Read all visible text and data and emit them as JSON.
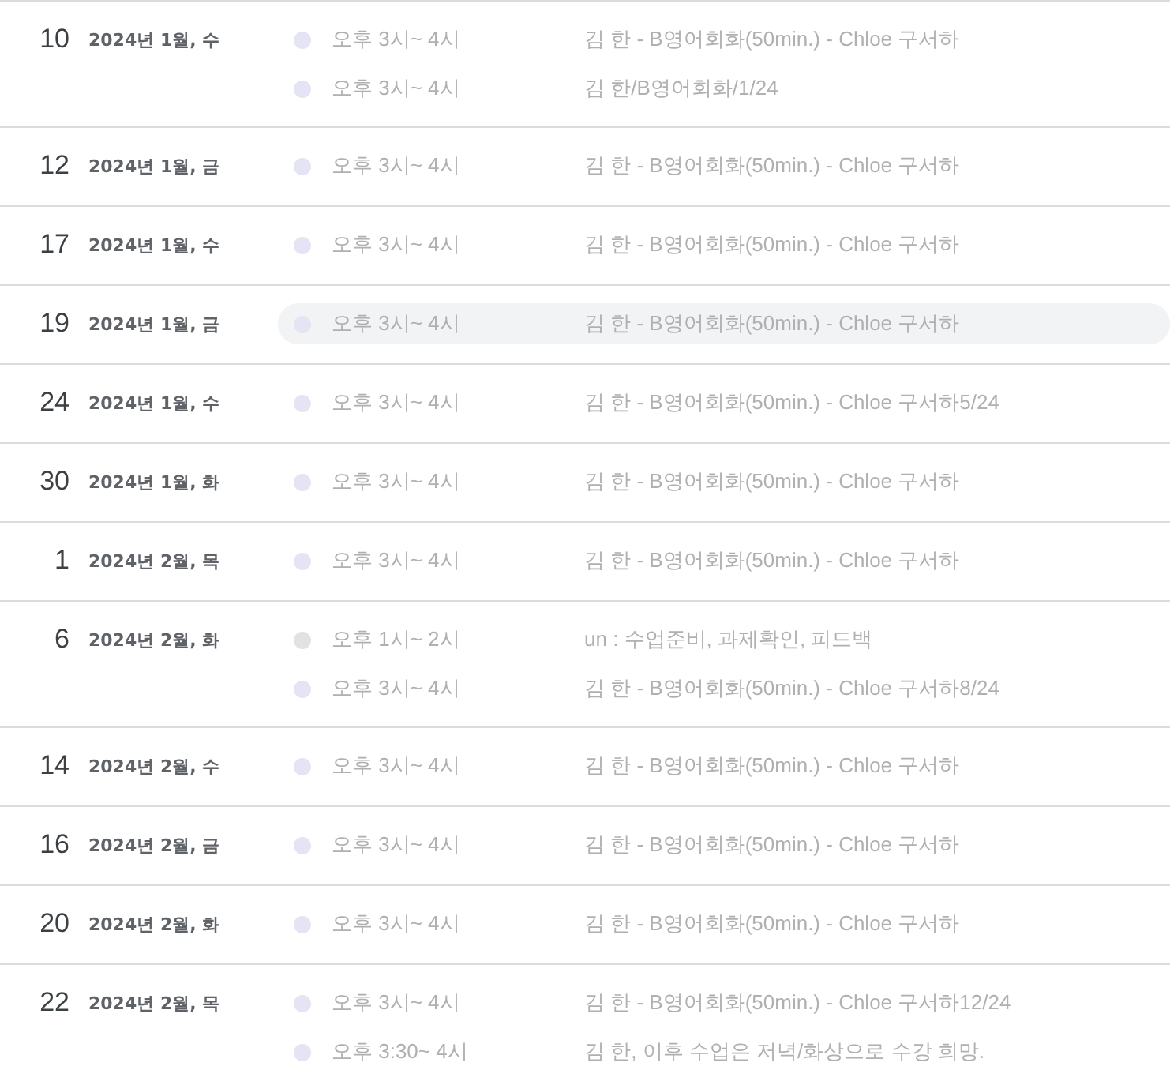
{
  "days": [
    {
      "day": "10",
      "date": "2024년 1월, 수",
      "events": [
        {
          "time": "오후 3시~ 4시",
          "title": "김   한 - B영어회화(50min.) - Chloe 구서하",
          "color": "#e4e4f4",
          "highlighted": false
        },
        {
          "time": "오후 3시~ 4시",
          "title": "김   한/B영어회화/1/24",
          "color": "#e4e4f4",
          "highlighted": false
        }
      ]
    },
    {
      "day": "12",
      "date": "2024년 1월, 금",
      "events": [
        {
          "time": "오후 3시~ 4시",
          "title": "김   한 - B영어회화(50min.) - Chloe 구서하",
          "color": "#e4e4f4",
          "highlighted": false
        }
      ]
    },
    {
      "day": "17",
      "date": "2024년 1월, 수",
      "events": [
        {
          "time": "오후 3시~ 4시",
          "title": "김   한 - B영어회화(50min.) - Chloe 구서하",
          "color": "#e4e4f4",
          "highlighted": false
        }
      ]
    },
    {
      "day": "19",
      "date": "2024년 1월, 금",
      "events": [
        {
          "time": "오후 3시~ 4시",
          "title": "김   한 - B영어회화(50min.) - Chloe 구서하",
          "color": "#e4e4f4",
          "highlighted": true
        }
      ]
    },
    {
      "day": "24",
      "date": "2024년 1월, 수",
      "events": [
        {
          "time": "오후 3시~ 4시",
          "title": "김   한 - B영어회화(50min.) - Chloe 구서하5/24",
          "color": "#e4e4f4",
          "highlighted": false
        }
      ]
    },
    {
      "day": "30",
      "date": "2024년 1월, 화",
      "events": [
        {
          "time": "오후 3시~ 4시",
          "title": "김   한 - B영어회화(50min.) - Chloe 구서하",
          "color": "#e4e4f4",
          "highlighted": false
        }
      ]
    },
    {
      "day": "1",
      "date": "2024년 2월, 목",
      "events": [
        {
          "time": "오후 3시~ 4시",
          "title": "김   한 - B영어회화(50min.) - Chloe 구서하",
          "color": "#e4e4f4",
          "highlighted": false
        }
      ]
    },
    {
      "day": "6",
      "date": "2024년 2월, 화",
      "events": [
        {
          "time": "오후 1시~ 2시",
          "title": "un : 수업준비, 과제확인, 피드백",
          "color": "#e2e2e2",
          "highlighted": false
        },
        {
          "time": "오후 3시~ 4시",
          "title": "김   한 - B영어회화(50min.) - Chloe 구서하8/24",
          "color": "#e4e4f4",
          "highlighted": false
        }
      ]
    },
    {
      "day": "14",
      "date": "2024년 2월, 수",
      "events": [
        {
          "time": "오후 3시~ 4시",
          "title": "김   한 - B영어회화(50min.) - Chloe 구서하",
          "color": "#e4e4f4",
          "highlighted": false
        }
      ]
    },
    {
      "day": "16",
      "date": "2024년 2월, 금",
      "events": [
        {
          "time": "오후 3시~ 4시",
          "title": "김   한 - B영어회화(50min.) - Chloe 구서하",
          "color": "#e4e4f4",
          "highlighted": false
        }
      ]
    },
    {
      "day": "20",
      "date": "2024년 2월, 화",
      "events": [
        {
          "time": "오후 3시~ 4시",
          "title": "김   한 - B영어회화(50min.) - Chloe 구서하",
          "color": "#e4e4f4",
          "highlighted": false
        }
      ]
    },
    {
      "day": "22",
      "date": "2024년 2월, 목",
      "events": [
        {
          "time": "오후 3시~ 4시",
          "title": "김   한 - B영어회화(50min.) - Chloe 구서하12/24",
          "color": "#e4e4f4",
          "highlighted": false
        },
        {
          "time": "오후 3:30~ 4시",
          "title": "김   한, 이후 수업은 저녁/화상으로 수강 희망.",
          "color": "#e4e4f4",
          "highlighted": false
        }
      ]
    }
  ]
}
